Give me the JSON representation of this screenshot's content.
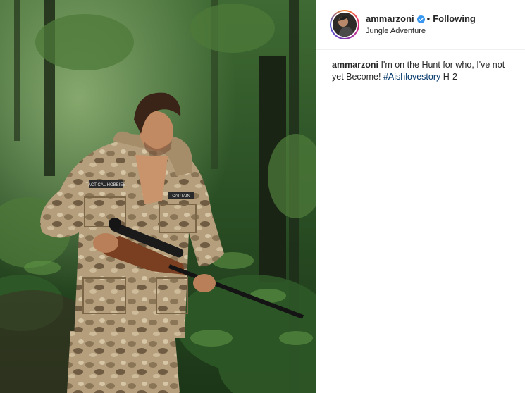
{
  "post": {
    "username": "ammarzoni",
    "verified_icon": "verified-badge-icon",
    "separator": "•",
    "follow_label": "Following",
    "location": "Jungle Adventure"
  },
  "caption": {
    "username": "ammarzoni",
    "text": "I'm on the Hunt for who, I've not yet Become!",
    "hashtag": "#Aishlovestory",
    "suffix": "H-2"
  },
  "photo": {
    "patch_left": "TACTICAL HOBBIES",
    "patch_right": "CAPTAIN"
  },
  "colors": {
    "verified_blue": "#3897f0",
    "hashtag_blue": "#003569",
    "text": "#262626"
  }
}
